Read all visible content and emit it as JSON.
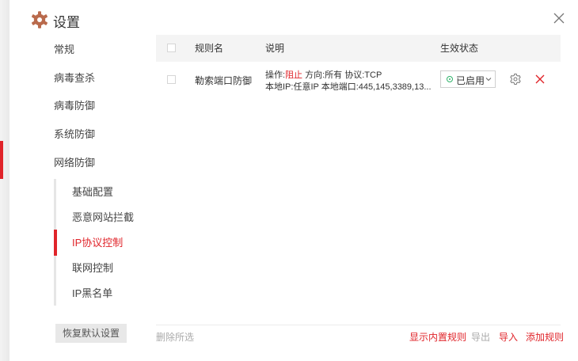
{
  "window": {
    "title": "设置"
  },
  "sidebar": {
    "items": [
      {
        "label": "常规"
      },
      {
        "label": "病毒查杀"
      },
      {
        "label": "病毒防御"
      },
      {
        "label": "系统防御"
      },
      {
        "label": "网络防御"
      }
    ],
    "sub_items": [
      {
        "label": "基础配置"
      },
      {
        "label": "恶意网站拦截"
      },
      {
        "label": "IP协议控制",
        "active": true
      },
      {
        "label": "联网控制"
      },
      {
        "label": "IP黑名单"
      }
    ],
    "restore_label": "恢复默认设置"
  },
  "table": {
    "headers": {
      "name": "规则名",
      "desc": "说明",
      "status": "生效状态"
    },
    "rows": [
      {
        "name": "勒索端口防御",
        "desc_prefix": "操作:",
        "desc_action": "阻止",
        "desc_rest": " 方向:所有 协议:TCP",
        "desc_line2": "本地IP:任意IP 本地端口:445,145,3389,13...",
        "status": "已启用"
      }
    ]
  },
  "footer": {
    "delete_selected": "删除所选",
    "show_builtin": "显示内置规则",
    "export": "导出",
    "import": "导入",
    "add_rule": "添加规则"
  },
  "colors": {
    "accent": "#e0242a",
    "enabled": "#2fb26a",
    "muted": "#aaaaaa"
  },
  "icons": {
    "title": "gear-icon",
    "close": "close-icon",
    "row_settings": "gear-icon",
    "row_delete": "close-icon",
    "dropdown": "chevron-down-icon"
  }
}
